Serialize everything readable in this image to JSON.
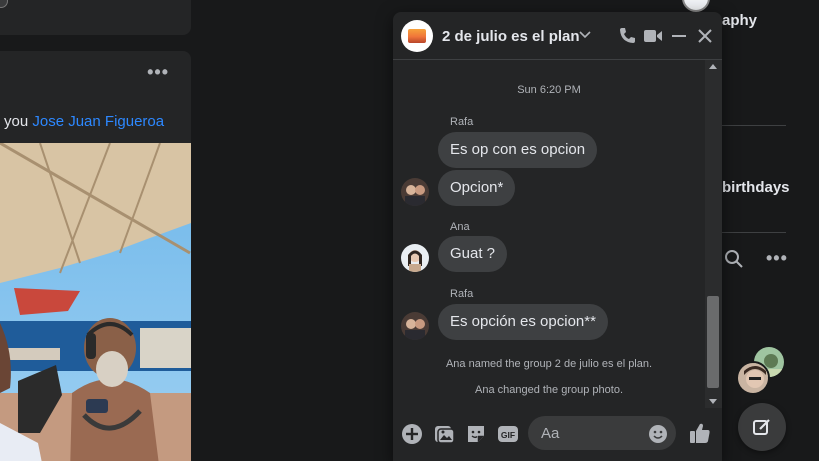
{
  "feed": {
    "post_text_prefix": "you ",
    "post_tagged_name": "Jose Juan Figueroa",
    "post_more": "•••"
  },
  "right_column": {
    "title_fragment": "aphy",
    "birthdays_fragment": "birthdays",
    "more": "•••"
  },
  "chat": {
    "title": "2 de julio es el plan",
    "timestamp": "Sun 6:20 PM",
    "messages": [
      {
        "sender": "Rafa",
        "text": "Es op con es opcion"
      },
      {
        "sender": "",
        "text": "Opcion*"
      },
      {
        "sender": "Ana",
        "text": "Guat ?"
      },
      {
        "sender": "Rafa",
        "text": "Es opción es opcion**"
      }
    ],
    "system_events": [
      "Ana named the group 2 de julio es el plan.",
      "Ana changed the group photo."
    ],
    "composer_placeholder": "Aa",
    "accent": "#0a7cff"
  }
}
